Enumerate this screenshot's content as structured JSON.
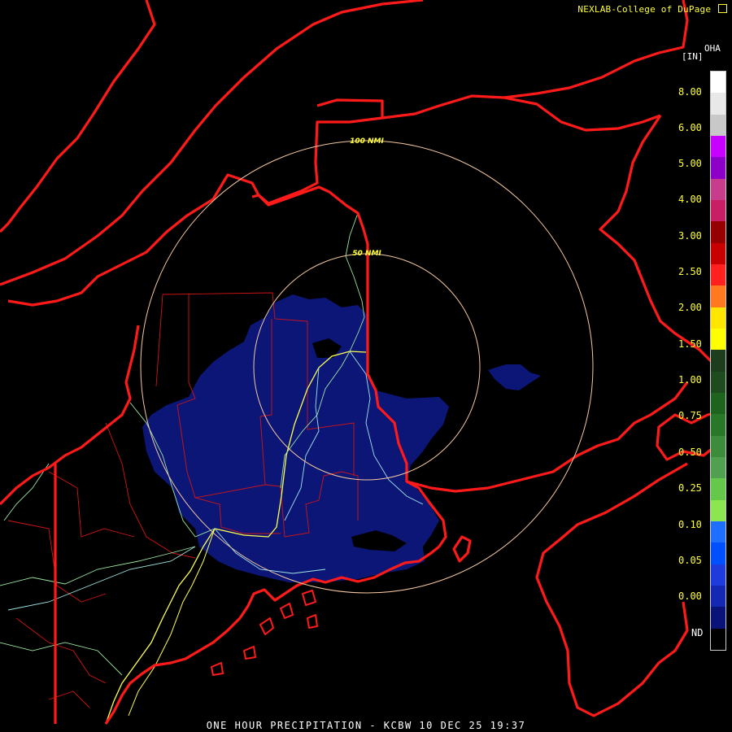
{
  "header": {
    "credit": "NEXLAB-College of DuPage",
    "credit_icon": "external-link-icon"
  },
  "footer": {
    "caption": "ONE HOUR PRECIPITATION - KCBW 10 DEC 25 19:37"
  },
  "legend": {
    "unit": "[IN]",
    "product": "OHA",
    "labels": [
      "8.00",
      "6.00",
      "5.00",
      "4.00",
      "3.00",
      "2.50",
      "2.00",
      "1.50",
      "1.00",
      "0.75",
      "0.50",
      "0.25",
      "0.10",
      "0.05",
      "0.00",
      "ND"
    ],
    "swatches": [
      "#ffffff",
      "#e8e8e8",
      "#c8c8c8",
      "#c800ff",
      "#8c00c8",
      "#c83c8c",
      "#c81e64",
      "#960000",
      "#c80000",
      "#ff2020",
      "#ff7a1e",
      "#ffe600",
      "#ffff00",
      "#1e3c1e",
      "#1e4c1e",
      "#1e641e",
      "#287828",
      "#3c8c3c",
      "#50a050",
      "#64c84a",
      "#8ce650",
      "#1e6eff",
      "#0050ff",
      "#1e3cdc",
      "#1428b4",
      "#0a1478",
      "#000000"
    ]
  },
  "map": {
    "rings": [
      {
        "label": "100 NMI",
        "color": "#f5c8a0"
      },
      {
        "label": "50 NMI",
        "color": "#f5c8a0"
      }
    ],
    "colors": {
      "coastline": "#ff1a1a",
      "county": "#d21414",
      "precip": "#0c1677",
      "precip_dark": "#182896",
      "roads_yellow": "#ffff4d",
      "roads_green": "#9ae6a0",
      "roads_cyan": "#a0e6e6"
    }
  }
}
